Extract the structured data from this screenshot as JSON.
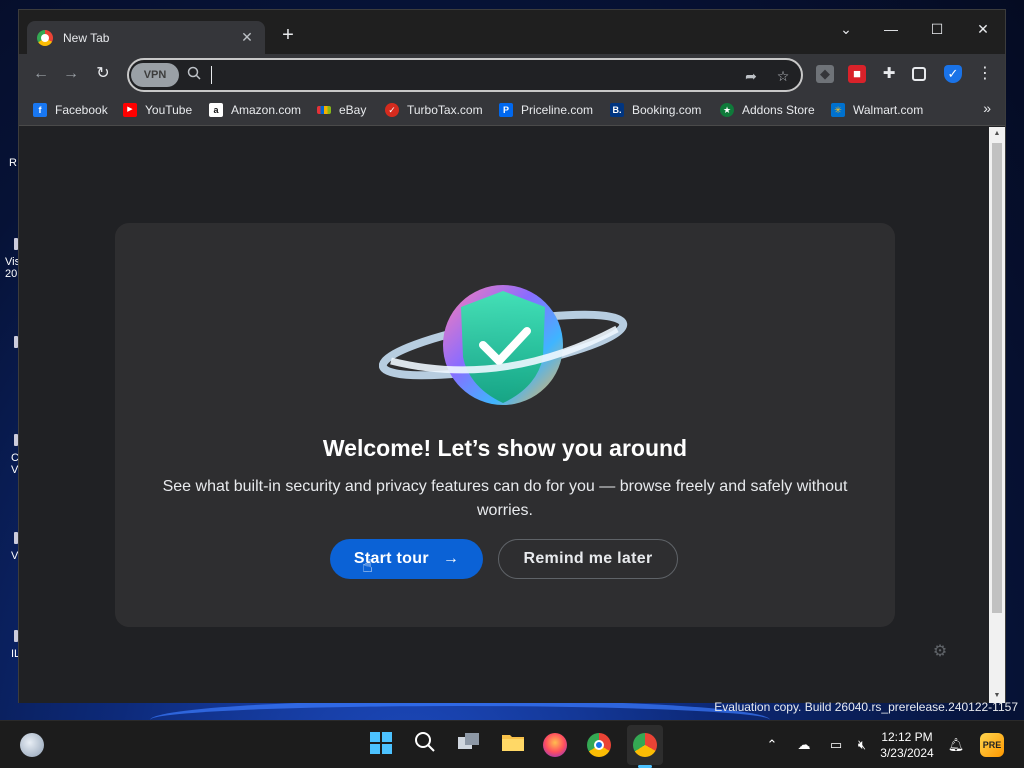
{
  "browser": {
    "tab": {
      "title": "New Tab",
      "close_icon": "close-icon"
    },
    "window_controls": {
      "dropdown": "⌄",
      "minimize": "—",
      "maximize": "☐",
      "close": "✕"
    },
    "toolbar": {
      "vpn_label": "VPN",
      "omnibox_value": "",
      "icons": [
        "back-arrow-icon",
        "forward-arrow-icon",
        "reload-icon",
        "search-icon",
        "share-icon",
        "star-icon"
      ]
    },
    "extensions": [
      "extension-icon-gray",
      "extension-icon-red",
      "puzzle-icon",
      "sidepanel-icon",
      "shield-icon",
      "menu-icon"
    ],
    "bookmarks": [
      {
        "label": "Facebook",
        "color": "#1877f2",
        "glyph": "f"
      },
      {
        "label": "YouTube",
        "color": "#ff0000",
        "glyph": "▶"
      },
      {
        "label": "Amazon.com",
        "color": "#ffffff",
        "glyph": "a"
      },
      {
        "label": "eBay",
        "color": "#e53238",
        "glyph": "e"
      },
      {
        "label": "TurboTax.com",
        "color": "#d52b1e",
        "glyph": "✓"
      },
      {
        "label": "Priceline.com",
        "color": "#0068ef",
        "glyph": "P"
      },
      {
        "label": "Booking.com",
        "color": "#003580",
        "glyph": "B"
      },
      {
        "label": "Addons Store",
        "color": "#0f7a3a",
        "glyph": "★"
      },
      {
        "label": "Walmart.com",
        "color": "#0071ce",
        "glyph": "✳"
      }
    ],
    "more_bookmarks": "»"
  },
  "welcome_card": {
    "title": "Welcome! Let’s show you around",
    "subtitle": "See what built-in security and privacy features can do for you — browse freely and safely without worries.",
    "start_label": "Start tour",
    "start_arrow": "→",
    "remind_label": "Remind me later",
    "accent": "#0b62d6"
  },
  "watermark": "Evaluation copy. Build 26040.rs_prerelease.240122-1157",
  "taskbar": {
    "time": "12:12 PM",
    "date": "3/23/2024",
    "apps": [
      "start-icon",
      "search-icon",
      "task-view-icon",
      "file-explorer-icon",
      "firefox-icon",
      "chrome-icon",
      "avast-browser-icon"
    ]
  }
}
